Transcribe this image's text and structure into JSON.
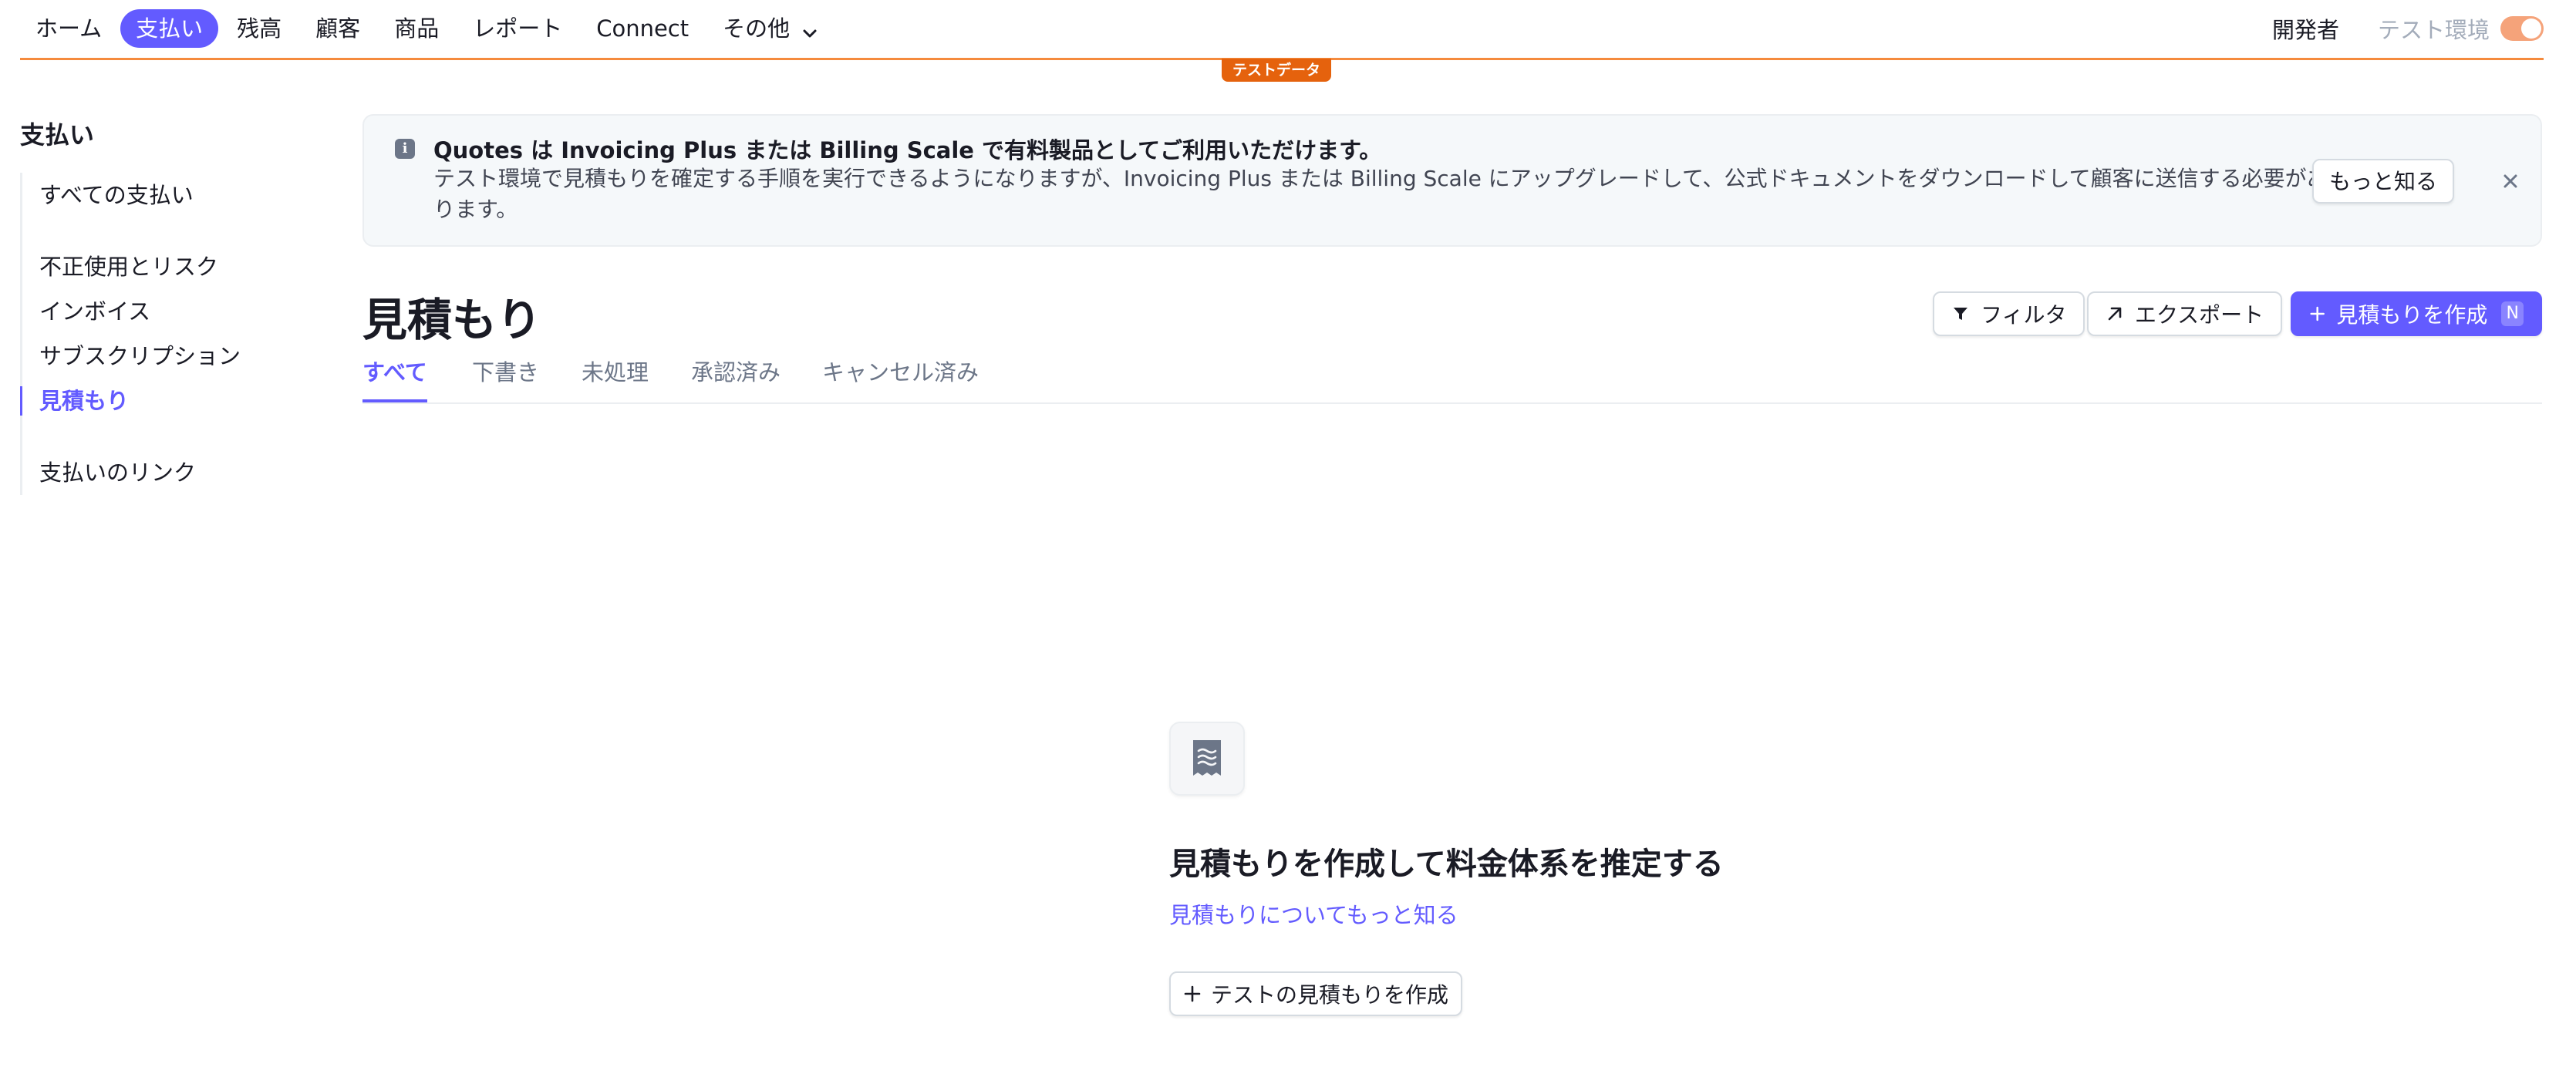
{
  "nav": {
    "items": [
      {
        "label": "ホーム",
        "active": false
      },
      {
        "label": "支払い",
        "active": true
      },
      {
        "label": "残高",
        "active": false
      },
      {
        "label": "顧客",
        "active": false
      },
      {
        "label": "商品",
        "active": false
      },
      {
        "label": "レポート",
        "active": false
      },
      {
        "label": "Connect",
        "active": false
      },
      {
        "label": "その他",
        "active": false
      }
    ],
    "developers": "開発者",
    "test_mode_label": "テスト環境",
    "test_mode_on": true
  },
  "test_badge": "テストデータ",
  "sidebar": {
    "title": "支払い",
    "items": [
      {
        "label": "すべての支払い"
      },
      {
        "label": "不正使用とリスク"
      },
      {
        "label": "インボイス"
      },
      {
        "label": "サブスクリプション"
      },
      {
        "label": "見積もり",
        "active": true
      },
      {
        "label": "支払いのリンク"
      }
    ]
  },
  "banner": {
    "title": "Quotes は Invoicing Plus または Billing Scale で有料製品としてご利用いただけます。",
    "body": "テスト環境で見積もりを確定する手順を実行できるようになりますが、Invoicing Plus または Billing Scale にアップグレードして、公式ドキュメントをダウンロードして顧客に送信する必要があります。",
    "learn_more": "もっと知る"
  },
  "page": {
    "title": "見積もり",
    "filter_label": "フィルタ",
    "export_label": "エクスポート",
    "create_label": "見積もりを作成",
    "create_shortcut": "N"
  },
  "tabs": [
    {
      "label": "すべて",
      "active": true
    },
    {
      "label": "下書き"
    },
    {
      "label": "未処理"
    },
    {
      "label": "承認済み"
    },
    {
      "label": "キャンセル済み"
    }
  ],
  "empty": {
    "title": "見積もりを作成して料金体系を推定する",
    "link": "見積もりについてもっと知る",
    "button": "テストの見積もりを作成"
  },
  "colors": {
    "accent": "#635bff",
    "test_orange": "#e5620d",
    "toggle": "#f5a37a"
  }
}
